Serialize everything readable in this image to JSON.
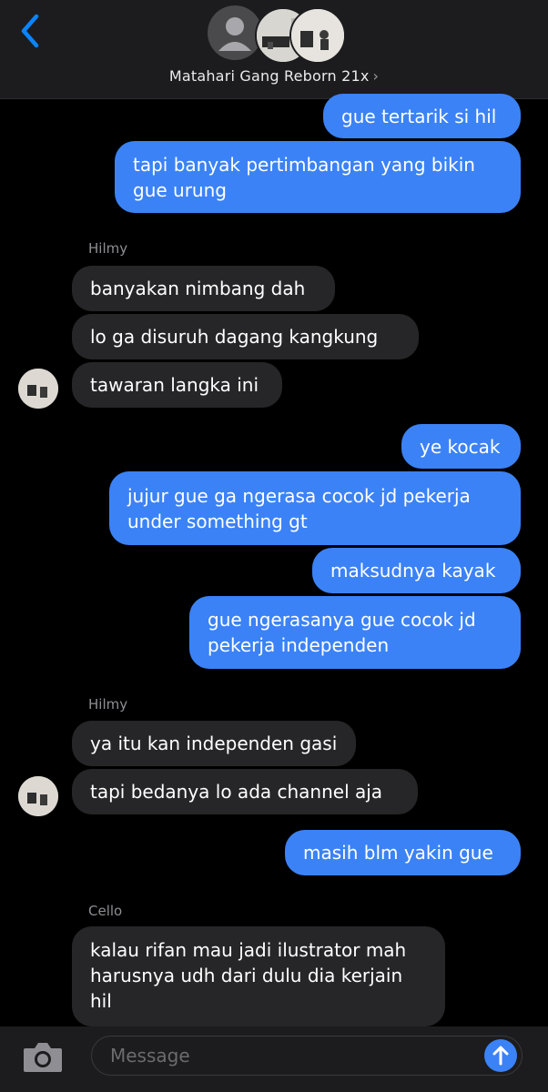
{
  "header": {
    "group_name": "Matahari Gang Reborn 21x",
    "chevron": "›"
  },
  "messages": [
    {
      "from": "me",
      "text": "gue tertarik si hil"
    },
    {
      "from": "me",
      "text": "tapi banyak pertimbangan yang bikin gue urung"
    },
    {
      "from": "Hilmy",
      "text": "banyakan nimbang dah"
    },
    {
      "from": "Hilmy",
      "text": "lo ga disuruh dagang kangkung"
    },
    {
      "from": "Hilmy",
      "text": "tawaran langka ini"
    },
    {
      "from": "me",
      "text": "ye kocak"
    },
    {
      "from": "me",
      "text": "jujur gue ga ngerasa cocok jd pekerja under something gt"
    },
    {
      "from": "me",
      "text": "maksudnya kayak"
    },
    {
      "from": "me",
      "text": "gue ngerasanya gue cocok jd pekerja independen"
    },
    {
      "from": "Hilmy",
      "text": "ya itu kan independen gasi"
    },
    {
      "from": "Hilmy",
      "text": "tapi bedanya lo ada channel aja"
    },
    {
      "from": "me",
      "text": "masih blm yakin gue"
    },
    {
      "from": "Cello",
      "text": "kalau rifan mau jadi ilustrator mah harusnya udh dari dulu dia kerjain hil"
    }
  ],
  "senders": {
    "first": "Hilmy",
    "second": "Hilmy",
    "third": "Cello"
  },
  "composer": {
    "placeholder": "Message"
  },
  "colors": {
    "my_bubble": "#3b82f6",
    "their_bubble": "#262628",
    "background": "#000000",
    "accent": "#0a84ff"
  },
  "icons": [
    "back-chevron-icon",
    "camera-icon",
    "send-arrow-icon"
  ]
}
